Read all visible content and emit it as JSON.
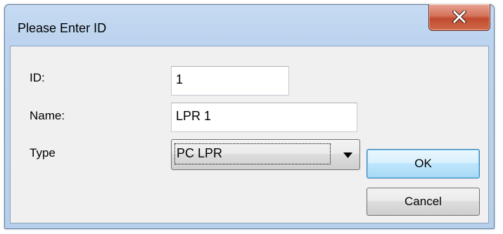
{
  "dialog": {
    "title": "Please Enter ID",
    "close_icon": "close-icon"
  },
  "form": {
    "id_label": "ID:",
    "id_value": "1",
    "name_label": "Name:",
    "name_value": "LPR 1",
    "type_label": "Type",
    "type_value": "PC LPR",
    "dropdown_icon": "chevron-down-icon"
  },
  "buttons": {
    "ok_label": "OK",
    "cancel_label": "Cancel"
  },
  "colors": {
    "frame": "#bcd4ef",
    "close_button": "#c24a2e",
    "default_button": "#bee6fd",
    "client_background": "#f0f0f0"
  }
}
